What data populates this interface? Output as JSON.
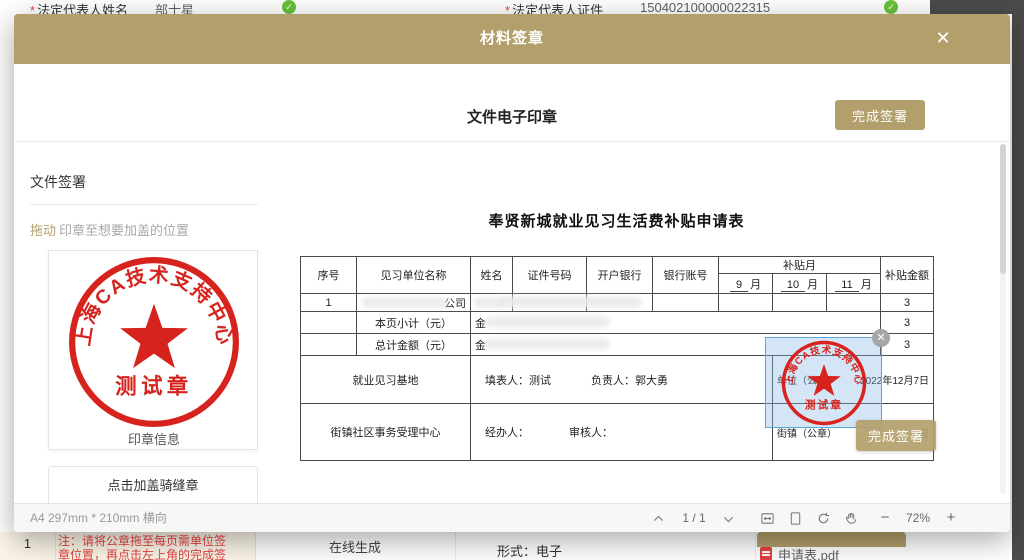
{
  "background": {
    "top_fields": [
      {
        "required": "*",
        "label": "法定代表人姓名",
        "value": "部士星"
      },
      {
        "required": "*",
        "label": "法定代表人证件",
        "value": "150402100000022315"
      }
    ],
    "bottom": {
      "row_no": "1",
      "note_line1": "注：请将公章拖至每页需单位签",
      "note_line2": "章位置，再点击左上角的完成签",
      "generate_mode": "在线生成",
      "format": "形式：电子",
      "file_name": "申请表.pdf"
    }
  },
  "modal": {
    "title": "材料签章",
    "close": "✕",
    "section_title": "文件电子印章",
    "finish_button": "完成签署",
    "sidebar": {
      "panel_title": "文件签署",
      "hint_drag": "拖动",
      "hint_rest": "印章至想要加盖的位置",
      "stamp_caption": "印章信息",
      "seam_stamp_button": "点击加盖骑缝章",
      "stamp": {
        "ring_text": "上海CA技术支持中心",
        "name": "测试章"
      }
    },
    "document": {
      "title": "奉贤新城就业见习生活费补贴申请表",
      "selection_close": "✕",
      "overlay_finish_button": "完成签署",
      "table": {
        "headers": [
          "序号",
          "见习单位名称",
          "姓名",
          "证件号码",
          "开户银行",
          "银行账号",
          "补贴月",
          "补贴金额"
        ],
        "months": [
          {
            "n": "9",
            "u": "月"
          },
          {
            "n": "10",
            "u": "月"
          },
          {
            "n": "11",
            "u": "月"
          }
        ],
        "row1": {
          "no": "1",
          "company_tail": "公司",
          "amount": "3"
        },
        "subtotal": {
          "label": "本页小计（元）",
          "prefix": "金",
          "amount": "3"
        },
        "total": {
          "label": "总计金额（元）",
          "prefix": "金",
          "amount": "3"
        },
        "base_row": {
          "label": "就业见习基地",
          "filler": "填表人：测试",
          "manager": "负责人：郭大勇",
          "seal": "单位（公章）",
          "date": "2022年12月7日"
        },
        "center_row": {
          "label": "街镇社区事务受理中心",
          "operator": "经办人：",
          "auditor": "审核人：",
          "seal": "街镇（公章）",
          "date": "日"
        }
      }
    },
    "toolbar": {
      "paper_size": "A4 297mm * 210mm 横向",
      "page_indicator": "1 / 1",
      "zoom_level": "72%",
      "zoom_out": "−",
      "zoom_in": "+",
      "icons": [
        "page-up",
        "page-down",
        "fit-width",
        "fit-page",
        "rotate",
        "hand",
        "zoom-out",
        "zoom-in"
      ]
    }
  },
  "colors": {
    "accent_gold": "#b29f6b",
    "stamp_red": "#d7231d",
    "success_green": "#67c23a",
    "note_red": "#e64242",
    "selection_blue": "#5da6dd"
  }
}
